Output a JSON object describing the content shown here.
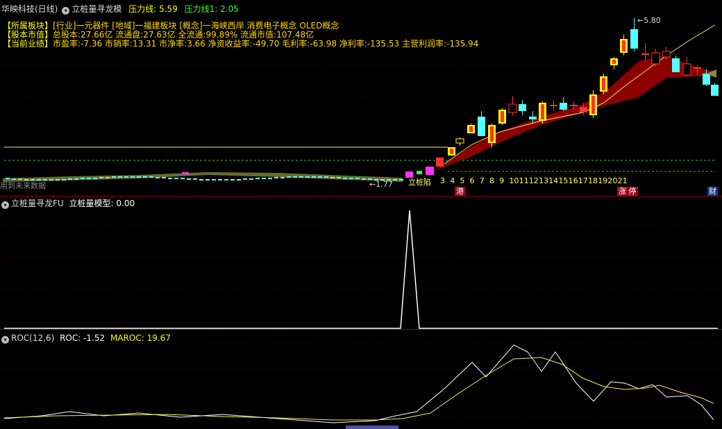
{
  "panel1": {
    "stock_name": "华映科技(日线)",
    "indicator_name": "立桩量寻龙模",
    "pressure_label": "压力线: 5.59",
    "pressure1_label": "压力线1: 2.05",
    "info_lines": [
      {
        "label": "【所属板块】",
        "text": "[行业]一元器件 [地域]一福建板块 [概念]一海峡西岸 消费电子概念 OLED概念"
      },
      {
        "label": "【股本市值】",
        "text": "总股本:27.66亿 流通盘:27.63亿 全流通:99.89% 流通市值:107.48亿"
      },
      {
        "label": "【当前业绩】",
        "text": "市盈率:-7.36 市销率:13.31 市净率:3.66 净资收益率:-49.70 毛利率:-63.98 净利率:-135.53 主营利润率:-135.94"
      }
    ],
    "high_label": "5.80",
    "low_label": "1.77",
    "left_label": "用到未来数据",
    "start_label": "立桩陷",
    "count_labels": [
      "3",
      "4",
      "5",
      "6",
      "7",
      "8",
      "9",
      "10",
      "11",
      "12",
      "13",
      "14",
      "15",
      "16",
      "17",
      "18",
      "19",
      "20",
      "21"
    ],
    "tag_gang": "港",
    "tag_zhangting": "涨 停",
    "tag_cai": "财",
    "colors": {
      "up": "#ff3232",
      "down": "#54ffff",
      "limit": "#ffff00",
      "ribbon": "#8b0000",
      "ribbon_old": "#6b6b2a",
      "ma": "#e6e67a"
    }
  },
  "panel2": {
    "name": "立桩量寻龙FU",
    "value_label": "立桩量模型: 0.00"
  },
  "panel3": {
    "name": "ROC(12,6)",
    "roc_label": "ROC: -1.52",
    "maroc_label": "MAROC: 19.67"
  }
}
